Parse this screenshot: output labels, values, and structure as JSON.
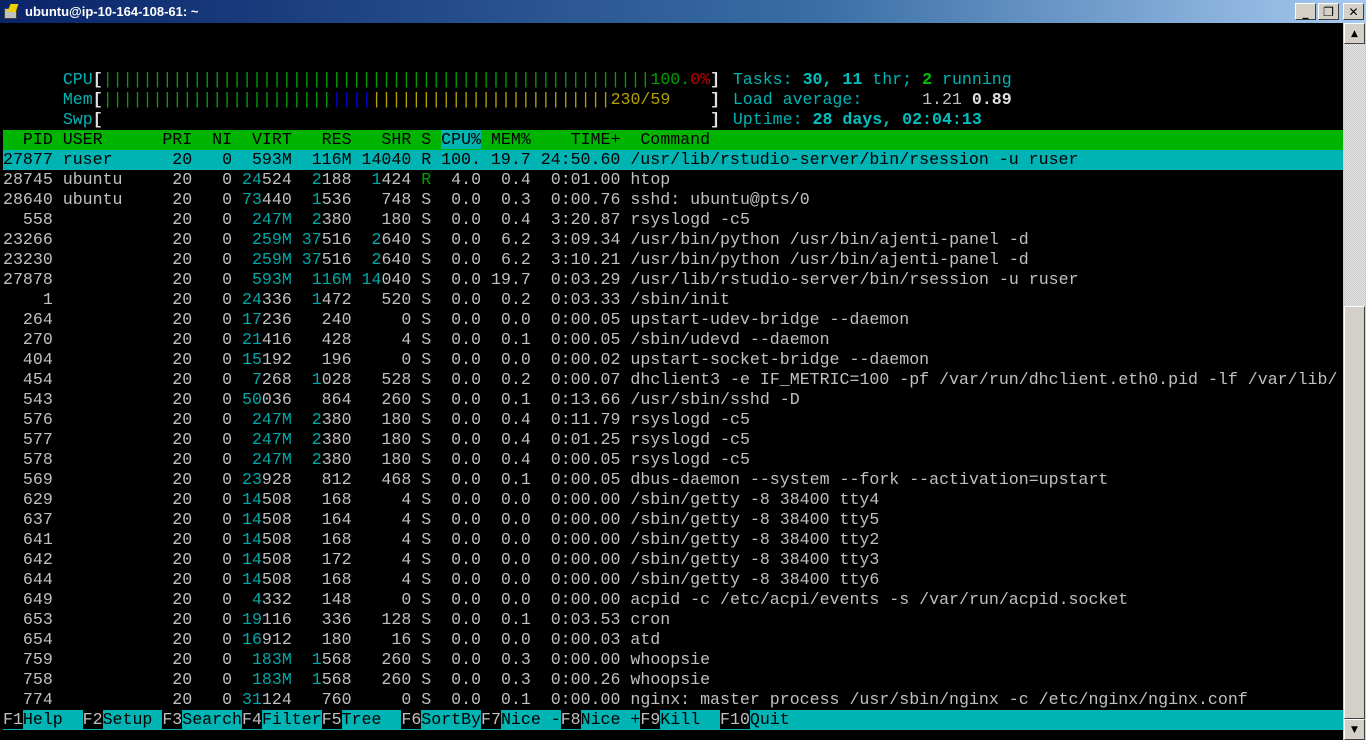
{
  "window": {
    "title": "ubuntu@ip-10-164-108-61: ~",
    "minimize_label": "_",
    "restore_label": "❐",
    "close_label": "✕"
  },
  "meters": {
    "cpu": {
      "label": "CPU",
      "value_text": "100.",
      "value_suffix": "0%",
      "percent": 100
    },
    "mem": {
      "label": "Mem",
      "value_text": "230/59",
      "used_fraction": 1.0
    },
    "swp": {
      "label": "Swp",
      "value_text": "",
      "used_fraction": 0
    }
  },
  "summary": {
    "tasks_label": "Tasks: ",
    "tasks_count": "30, 11",
    "threads_label": " thr; ",
    "running_count": "2",
    "running_label": " running",
    "load_label": "Load average: ",
    "load_1": "1.21",
    "load_5": "0.89",
    "uptime_label": "Uptime: ",
    "uptime_value": "28 days, 02:04:13"
  },
  "table": {
    "columns": [
      "PID",
      "USER",
      "PRI",
      "NI",
      "VIRT",
      "RES",
      "SHR",
      "S",
      "CPU%",
      "MEM%",
      "TIME+",
      "Command"
    ],
    "sort_column": "CPU%",
    "selected_index": 0,
    "rows": [
      {
        "pid": "27877",
        "user": "ruser",
        "pri": "20",
        "ni": "0",
        "virt": "593M",
        "res": "116M",
        "shr": "14040",
        "s": "R",
        "cpu": "100.",
        "mem": "19.7",
        "time": "24:50.60",
        "cmd": "/usr/lib/rstudio-server/bin/rsession -u ruser"
      },
      {
        "pid": "28745",
        "user": "ubuntu",
        "pri": "20",
        "ni": "0",
        "virt": "24524",
        "res": "2188",
        "shr": "1424",
        "s": "R",
        "cpu": "4.0",
        "mem": "0.4",
        "time": "0:01.00",
        "cmd": "htop"
      },
      {
        "pid": "28640",
        "user": "ubuntu",
        "pri": "20",
        "ni": "0",
        "virt": "73440",
        "res": "1536",
        "shr": "748",
        "s": "S",
        "cpu": "0.0",
        "mem": "0.3",
        "time": "0:00.76",
        "cmd": "sshd: ubuntu@pts/0"
      },
      {
        "pid": "558",
        "user": "",
        "pri": "20",
        "ni": "0",
        "virt": "247M",
        "res": "2380",
        "shr": "180",
        "s": "S",
        "cpu": "0.0",
        "mem": "0.4",
        "time": "3:20.87",
        "cmd": "rsyslogd -c5"
      },
      {
        "pid": "23266",
        "user": "",
        "pri": "20",
        "ni": "0",
        "virt": "259M",
        "res": "37516",
        "shr": "2640",
        "s": "S",
        "cpu": "0.0",
        "mem": "6.2",
        "time": "3:09.34",
        "cmd": "/usr/bin/python /usr/bin/ajenti-panel -d"
      },
      {
        "pid": "23230",
        "user": "",
        "pri": "20",
        "ni": "0",
        "virt": "259M",
        "res": "37516",
        "shr": "2640",
        "s": "S",
        "cpu": "0.0",
        "mem": "6.2",
        "time": "3:10.21",
        "cmd": "/usr/bin/python /usr/bin/ajenti-panel -d"
      },
      {
        "pid": "27878",
        "user": "",
        "pri": "20",
        "ni": "0",
        "virt": "593M",
        "res": "116M",
        "shr": "14040",
        "s": "S",
        "cpu": "0.0",
        "mem": "19.7",
        "time": "0:03.29",
        "cmd": "/usr/lib/rstudio-server/bin/rsession -u ruser"
      },
      {
        "pid": "1",
        "user": "",
        "pri": "20",
        "ni": "0",
        "virt": "24336",
        "res": "1472",
        "shr": "520",
        "s": "S",
        "cpu": "0.0",
        "mem": "0.2",
        "time": "0:03.33",
        "cmd": "/sbin/init"
      },
      {
        "pid": "264",
        "user": "",
        "pri": "20",
        "ni": "0",
        "virt": "17236",
        "res": "240",
        "shr": "0",
        "s": "S",
        "cpu": "0.0",
        "mem": "0.0",
        "time": "0:00.05",
        "cmd": "upstart-udev-bridge --daemon"
      },
      {
        "pid": "270",
        "user": "",
        "pri": "20",
        "ni": "0",
        "virt": "21416",
        "res": "428",
        "shr": "4",
        "s": "S",
        "cpu": "0.0",
        "mem": "0.1",
        "time": "0:00.05",
        "cmd": "/sbin/udevd --daemon"
      },
      {
        "pid": "404",
        "user": "",
        "pri": "20",
        "ni": "0",
        "virt": "15192",
        "res": "196",
        "shr": "0",
        "s": "S",
        "cpu": "0.0",
        "mem": "0.0",
        "time": "0:00.02",
        "cmd": "upstart-socket-bridge --daemon"
      },
      {
        "pid": "454",
        "user": "",
        "pri": "20",
        "ni": "0",
        "virt": "7268",
        "res": "1028",
        "shr": "528",
        "s": "S",
        "cpu": "0.0",
        "mem": "0.2",
        "time": "0:00.07",
        "cmd": "dhclient3 -e IF_METRIC=100 -pf /var/run/dhclient.eth0.pid -lf /var/lib/"
      },
      {
        "pid": "543",
        "user": "",
        "pri": "20",
        "ni": "0",
        "virt": "50036",
        "res": "864",
        "shr": "260",
        "s": "S",
        "cpu": "0.0",
        "mem": "0.1",
        "time": "0:13.66",
        "cmd": "/usr/sbin/sshd -D"
      },
      {
        "pid": "576",
        "user": "",
        "pri": "20",
        "ni": "0",
        "virt": "247M",
        "res": "2380",
        "shr": "180",
        "s": "S",
        "cpu": "0.0",
        "mem": "0.4",
        "time": "0:11.79",
        "cmd": "rsyslogd -c5"
      },
      {
        "pid": "577",
        "user": "",
        "pri": "20",
        "ni": "0",
        "virt": "247M",
        "res": "2380",
        "shr": "180",
        "s": "S",
        "cpu": "0.0",
        "mem": "0.4",
        "time": "0:01.25",
        "cmd": "rsyslogd -c5"
      },
      {
        "pid": "578",
        "user": "",
        "pri": "20",
        "ni": "0",
        "virt": "247M",
        "res": "2380",
        "shr": "180",
        "s": "S",
        "cpu": "0.0",
        "mem": "0.4",
        "time": "0:00.05",
        "cmd": "rsyslogd -c5"
      },
      {
        "pid": "569",
        "user": "",
        "pri": "20",
        "ni": "0",
        "virt": "23928",
        "res": "812",
        "shr": "468",
        "s": "S",
        "cpu": "0.0",
        "mem": "0.1",
        "time": "0:00.05",
        "cmd": "dbus-daemon --system --fork --activation=upstart"
      },
      {
        "pid": "629",
        "user": "",
        "pri": "20",
        "ni": "0",
        "virt": "14508",
        "res": "168",
        "shr": "4",
        "s": "S",
        "cpu": "0.0",
        "mem": "0.0",
        "time": "0:00.00",
        "cmd": "/sbin/getty -8 38400 tty4"
      },
      {
        "pid": "637",
        "user": "",
        "pri": "20",
        "ni": "0",
        "virt": "14508",
        "res": "164",
        "shr": "4",
        "s": "S",
        "cpu": "0.0",
        "mem": "0.0",
        "time": "0:00.00",
        "cmd": "/sbin/getty -8 38400 tty5"
      },
      {
        "pid": "641",
        "user": "",
        "pri": "20",
        "ni": "0",
        "virt": "14508",
        "res": "168",
        "shr": "4",
        "s": "S",
        "cpu": "0.0",
        "mem": "0.0",
        "time": "0:00.00",
        "cmd": "/sbin/getty -8 38400 tty2"
      },
      {
        "pid": "642",
        "user": "",
        "pri": "20",
        "ni": "0",
        "virt": "14508",
        "res": "172",
        "shr": "4",
        "s": "S",
        "cpu": "0.0",
        "mem": "0.0",
        "time": "0:00.00",
        "cmd": "/sbin/getty -8 38400 tty3"
      },
      {
        "pid": "644",
        "user": "",
        "pri": "20",
        "ni": "0",
        "virt": "14508",
        "res": "168",
        "shr": "4",
        "s": "S",
        "cpu": "0.0",
        "mem": "0.0",
        "time": "0:00.00",
        "cmd": "/sbin/getty -8 38400 tty6"
      },
      {
        "pid": "649",
        "user": "",
        "pri": "20",
        "ni": "0",
        "virt": "4332",
        "res": "148",
        "shr": "0",
        "s": "S",
        "cpu": "0.0",
        "mem": "0.0",
        "time": "0:00.00",
        "cmd": "acpid -c /etc/acpi/events -s /var/run/acpid.socket"
      },
      {
        "pid": "653",
        "user": "",
        "pri": "20",
        "ni": "0",
        "virt": "19116",
        "res": "336",
        "shr": "128",
        "s": "S",
        "cpu": "0.0",
        "mem": "0.1",
        "time": "0:03.53",
        "cmd": "cron"
      },
      {
        "pid": "654",
        "user": "",
        "pri": "20",
        "ni": "0",
        "virt": "16912",
        "res": "180",
        "shr": "16",
        "s": "S",
        "cpu": "0.0",
        "mem": "0.0",
        "time": "0:00.03",
        "cmd": "atd"
      },
      {
        "pid": "759",
        "user": "",
        "pri": "20",
        "ni": "0",
        "virt": "183M",
        "res": "1568",
        "shr": "260",
        "s": "S",
        "cpu": "0.0",
        "mem": "0.3",
        "time": "0:00.00",
        "cmd": "whoopsie"
      },
      {
        "pid": "758",
        "user": "",
        "pri": "20",
        "ni": "0",
        "virt": "183M",
        "res": "1568",
        "shr": "260",
        "s": "S",
        "cpu": "0.0",
        "mem": "0.3",
        "time": "0:00.26",
        "cmd": "whoopsie"
      },
      {
        "pid": "774",
        "user": "",
        "pri": "20",
        "ni": "0",
        "virt": "31124",
        "res": "760",
        "shr": "0",
        "s": "S",
        "cpu": "0.0",
        "mem": "0.1",
        "time": "0:00.00",
        "cmd": "nginx: master process /usr/sbin/nginx -c /etc/nginx/nginx.conf"
      }
    ]
  },
  "function_keys": [
    {
      "key": "F1",
      "label": "Help  "
    },
    {
      "key": "F2",
      "label": "Setup "
    },
    {
      "key": "F3",
      "label": "Search"
    },
    {
      "key": "F4",
      "label": "Filter"
    },
    {
      "key": "F5",
      "label": "Tree  "
    },
    {
      "key": "F6",
      "label": "SortBy"
    },
    {
      "key": "F7",
      "label": "Nice -"
    },
    {
      "key": "F8",
      "label": "Nice +"
    },
    {
      "key": "F9",
      "label": "Kill  "
    },
    {
      "key": "F10",
      "label": "Quit"
    }
  ],
  "scrollbar": {
    "up_icon": "▲",
    "down_icon": "▼",
    "position_fraction": 0.0
  }
}
